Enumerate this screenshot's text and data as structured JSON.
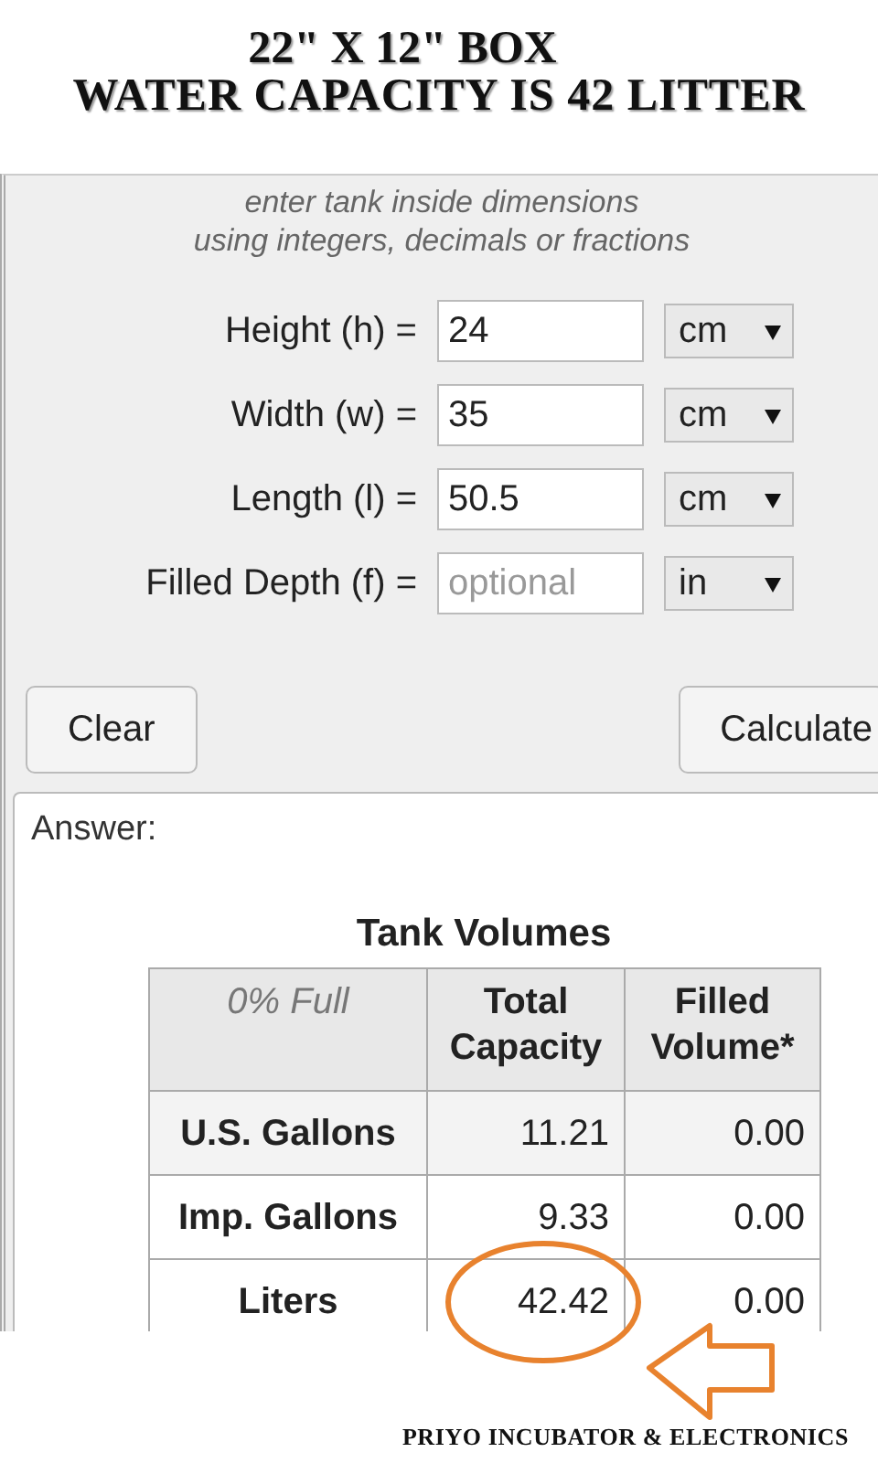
{
  "caption": {
    "line_1": "22\" X 12\" BOX",
    "line_2": "WATER CAPACITY IS 42 LITTER"
  },
  "hint": {
    "line_1": "enter tank inside dimensions",
    "line_2": "using integers, decimals or fractions"
  },
  "fields": [
    {
      "label": "Height (h) =",
      "value": "24",
      "unit": "cm"
    },
    {
      "label": "Width (w) =",
      "value": "35",
      "unit": "cm"
    },
    {
      "label": "Length (l) =",
      "value": "50.5",
      "unit": "cm"
    },
    {
      "label": "Filled Depth (f) =",
      "placeholder": "optional",
      "unit": "in"
    }
  ],
  "buttons": [
    "Clear",
    "Calculate"
  ],
  "answer": {
    "label": "Answer:",
    "table": {
      "title": "Tank Volumes",
      "columns": [
        "0% Full",
        "Total Capacity",
        "Filled Volume*"
      ],
      "rows": [
        {
          "unit": "U.S. Gallons",
          "total": "11.21",
          "filled": "0.00"
        },
        {
          "unit": "Imp. Gallons",
          "total": "9.33",
          "filled": "0.00"
        },
        {
          "unit": "Liters",
          "total": "42.42",
          "filled": "0.00"
        }
      ]
    }
  },
  "footer": "PRIYO INCUBATOR & ELECTRONICS"
}
